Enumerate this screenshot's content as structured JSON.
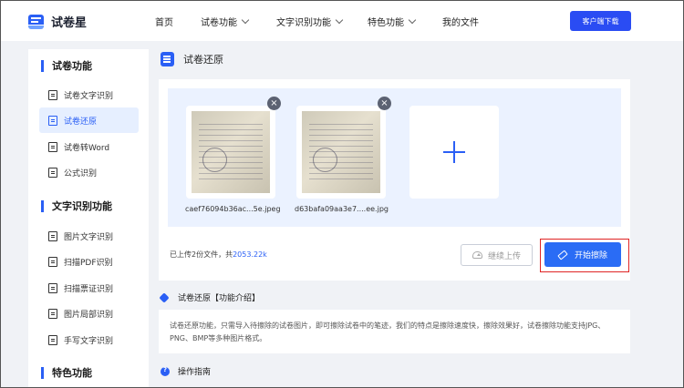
{
  "header": {
    "logo_text": "试卷星",
    "nav": [
      {
        "label": "首页",
        "has_dropdown": false
      },
      {
        "label": "试卷功能",
        "has_dropdown": true
      },
      {
        "label": "文字识别功能",
        "has_dropdown": true
      },
      {
        "label": "特色功能",
        "has_dropdown": true
      },
      {
        "label": "我的文件",
        "has_dropdown": false
      }
    ],
    "download_label": "客户端下载"
  },
  "sidebar": {
    "sections": [
      {
        "title": "试卷功能",
        "items": [
          {
            "label": "试卷文字识别",
            "active": false
          },
          {
            "label": "试卷还原",
            "active": true
          },
          {
            "label": "试卷转Word",
            "active": false
          },
          {
            "label": "公式识别",
            "active": false
          }
        ]
      },
      {
        "title": "文字识别功能",
        "items": [
          {
            "label": "图片文字识别",
            "active": false
          },
          {
            "label": "扫描PDF识别",
            "active": false
          },
          {
            "label": "扫描票证识别",
            "active": false
          },
          {
            "label": "图片局部识别",
            "active": false
          },
          {
            "label": "手写文字识别",
            "active": false
          }
        ]
      },
      {
        "title": "特色功能",
        "items": []
      }
    ]
  },
  "main": {
    "title": "试卷还原",
    "files": [
      {
        "name": "caef76094b36ac...5e.jpeg"
      },
      {
        "name": "d63bafa09aa3e7....ee.jpg"
      }
    ],
    "remove_glyph": "×",
    "summary_prefix": "已上传2份文件，共",
    "summary_size": "2053.22k",
    "continue_label": "继续上传",
    "start_label": "开始擦除",
    "intro_title": "试卷还原【功能介绍】",
    "intro_text": "试卷还原功能，只需导入待擦除的试卷图片，即可擦除试卷中的笔迹，我们的特点是擦除速度快，擦除效果好，试卷擦除功能支持JPG、PNG、BMP等多种图片格式。",
    "guide_title": "操作指南"
  },
  "colors": {
    "accent": "#2a5ff5",
    "download_button": "#2a4cf3",
    "upload_area": "#ebf2ff",
    "highlight_outline": "#e02424"
  }
}
